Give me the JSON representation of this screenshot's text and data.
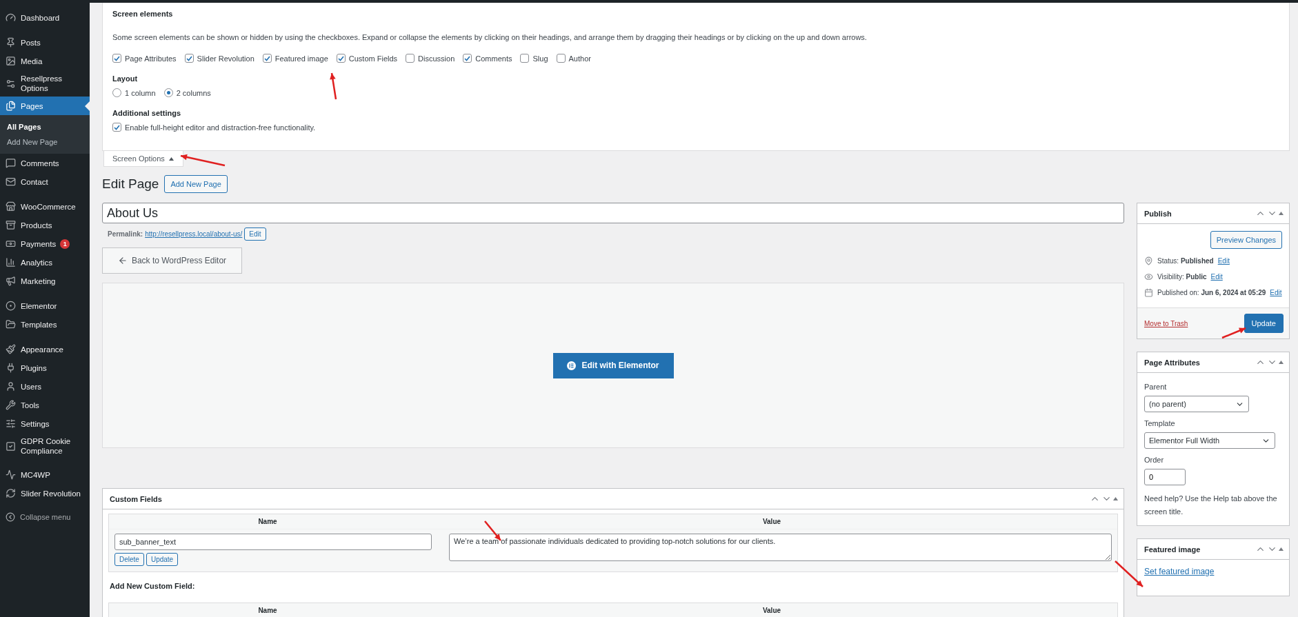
{
  "sidebar": {
    "groups": [
      {
        "items": [
          {
            "label": "Dashboard",
            "selected": false
          }
        ]
      },
      {
        "items": [
          {
            "label": "Posts",
            "selected": false
          },
          {
            "label": "Media",
            "selected": false
          },
          {
            "label": "Resellpress Options",
            "selected": false
          },
          {
            "label": "Pages",
            "selected": true,
            "children": [
              {
                "label": "All Pages",
                "selected": true
              },
              {
                "label": "Add New Page",
                "selected": false
              }
            ]
          },
          {
            "label": "Comments",
            "selected": false
          },
          {
            "label": "Contact",
            "selected": false
          }
        ]
      },
      {
        "items": [
          {
            "label": "WooCommerce",
            "selected": false
          },
          {
            "label": "Products",
            "selected": false
          },
          {
            "label": "Payments",
            "selected": false,
            "badge": "1"
          },
          {
            "label": "Analytics",
            "selected": false
          },
          {
            "label": "Marketing",
            "selected": false
          }
        ]
      },
      {
        "items": [
          {
            "label": "Elementor",
            "selected": false
          },
          {
            "label": "Templates",
            "selected": false
          }
        ]
      },
      {
        "items": [
          {
            "label": "Appearance",
            "selected": false
          },
          {
            "label": "Plugins",
            "selected": false
          },
          {
            "label": "Users",
            "selected": false
          },
          {
            "label": "Tools",
            "selected": false
          },
          {
            "label": "Settings",
            "selected": false
          },
          {
            "label": "GDPR Cookie Compliance",
            "selected": false
          }
        ]
      },
      {
        "items": [
          {
            "label": "MC4WP",
            "selected": false
          },
          {
            "label": "Slider Revolution",
            "selected": false
          }
        ]
      }
    ],
    "collapse_menu": {
      "label": "Collapse menu"
    }
  },
  "screen_options": {
    "heading": "Screen elements",
    "description": "Some screen elements can be shown or hidden by using the checkboxes. Expand or collapse the elements by clicking on their headings, and arrange them by dragging their headings or by clicking on the up and down arrows.",
    "elements": [
      {
        "label": "Page Attributes",
        "checked": true
      },
      {
        "label": "Slider Revolution",
        "checked": true
      },
      {
        "label": "Featured image",
        "checked": true
      },
      {
        "label": "Custom Fields",
        "checked": true
      },
      {
        "label": "Discussion",
        "checked": false
      },
      {
        "label": "Comments",
        "checked": true
      },
      {
        "label": "Slug",
        "checked": false
      },
      {
        "label": "Author",
        "checked": false
      }
    ],
    "layout": {
      "heading": "Layout",
      "options": [
        {
          "label": "1 column",
          "selected": false
        },
        {
          "label": "2 columns",
          "selected": true
        }
      ]
    },
    "additional": {
      "heading": "Additional settings",
      "options": [
        {
          "label": "Enable full-height editor and distraction-free functionality.",
          "checked": true
        }
      ]
    },
    "toggle": {
      "label": "Screen Options",
      "expanded": true
    }
  },
  "page_header": {
    "title": "Edit Page",
    "button": "Add New Page"
  },
  "title_field": {
    "value": "About Us"
  },
  "permalink": {
    "label": "Permalink:",
    "url": "http://resellpress.local/about-us/",
    "button": "Edit"
  },
  "back_button": {
    "label": "Back to WordPress Editor"
  },
  "elementor": {
    "button": "Edit with Elementor"
  },
  "custom_fields": {
    "title": "Custom Fields",
    "columns": [
      "Name",
      "Value"
    ],
    "rows": [
      {
        "name": "sub_banner_text",
        "value": "We’re a team of passionate individuals dedicated to providing top-notch solutions for our clients.",
        "buttons": [
          "Delete",
          "Update"
        ]
      }
    ],
    "add_new": {
      "heading": "Add New Custom Field:",
      "columns": [
        "Name",
        "Value"
      ]
    }
  },
  "publish": {
    "title": "Publish",
    "preview_button": "Preview Changes",
    "meta": [
      {
        "text": "Status: **Published**",
        "link": "Edit"
      },
      {
        "text": "Visibility: **Public**",
        "link": "Edit"
      },
      {
        "text": "Published on: **Jun 6, 2024 at 05:29**",
        "link": "Edit"
      }
    ],
    "trash_link": "Move to Trash",
    "update_button": "Update"
  },
  "page_attributes": {
    "title": "Page Attributes",
    "parent": {
      "label": "Parent",
      "value": "(no parent)"
    },
    "template": {
      "label": "Template",
      "value": "Elementor Full Width"
    },
    "order": {
      "label": "Order",
      "value": "0"
    },
    "help": "Need help? Use the Help tab above the screen title."
  },
  "featured_image": {
    "title": "Featured image",
    "link": "Set featured image"
  }
}
